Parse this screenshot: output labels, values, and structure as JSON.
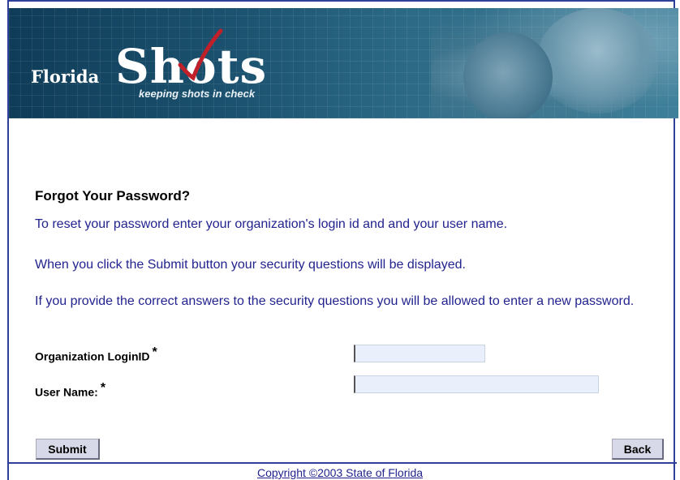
{
  "banner": {
    "logo_florida": "Florida",
    "logo_shots": "Shots",
    "tagline": "keeping shots in check"
  },
  "form": {
    "title": "Forgot Your Password?",
    "instructions": [
      "To reset your password enter your organization's login id and and your user name.",
      "When you click the Submit button your security questions will be displayed.",
      "If you provide the correct answers to the security questions you will be allowed to enter a new password."
    ],
    "org_login_label": "Organization LoginID",
    "user_name_label": "User Name:",
    "required_marker": "*",
    "org_login_value": "",
    "user_name_value": ""
  },
  "buttons": {
    "submit": "Submit",
    "back": "Back"
  },
  "footer": {
    "copyright": "Copyright ©2003 State of Florida"
  },
  "colors": {
    "text_blue": "#22238f",
    "frame_blue": "#2f3f9a",
    "input_bg": "#e9f0fb"
  }
}
